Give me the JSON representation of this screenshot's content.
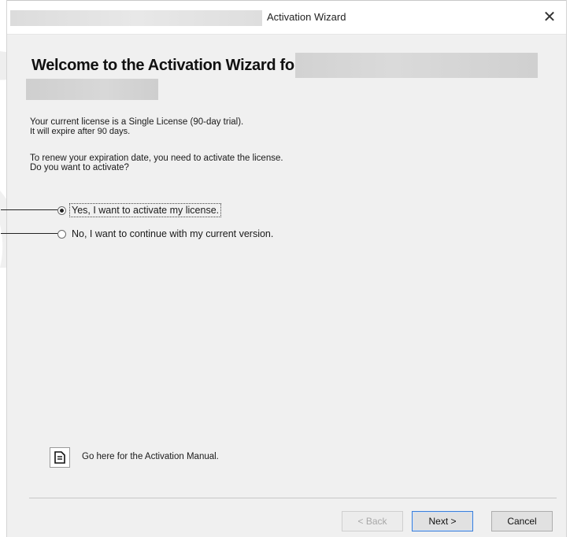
{
  "window": {
    "title": "Activation Wizard",
    "close_glyph": "✕"
  },
  "heading": "Welcome to the Activation Wizard for",
  "info": {
    "line1": "Your current license is a Single License (90-day trial).",
    "line2": "It will expire after 90 days.",
    "line3": "To renew your expiration date, you need to activate the license.",
    "line4": "Do you want to activate?"
  },
  "options": [
    {
      "label": "Yes, I want to activate my license.",
      "checked": true
    },
    {
      "label": "No, I want to continue with my current version.",
      "checked": false
    }
  ],
  "manual": {
    "icon": "document-icon",
    "label": "Go here for the Activation Manual."
  },
  "buttons": {
    "back": "< Back",
    "next": "Next >",
    "cancel": "Cancel"
  }
}
